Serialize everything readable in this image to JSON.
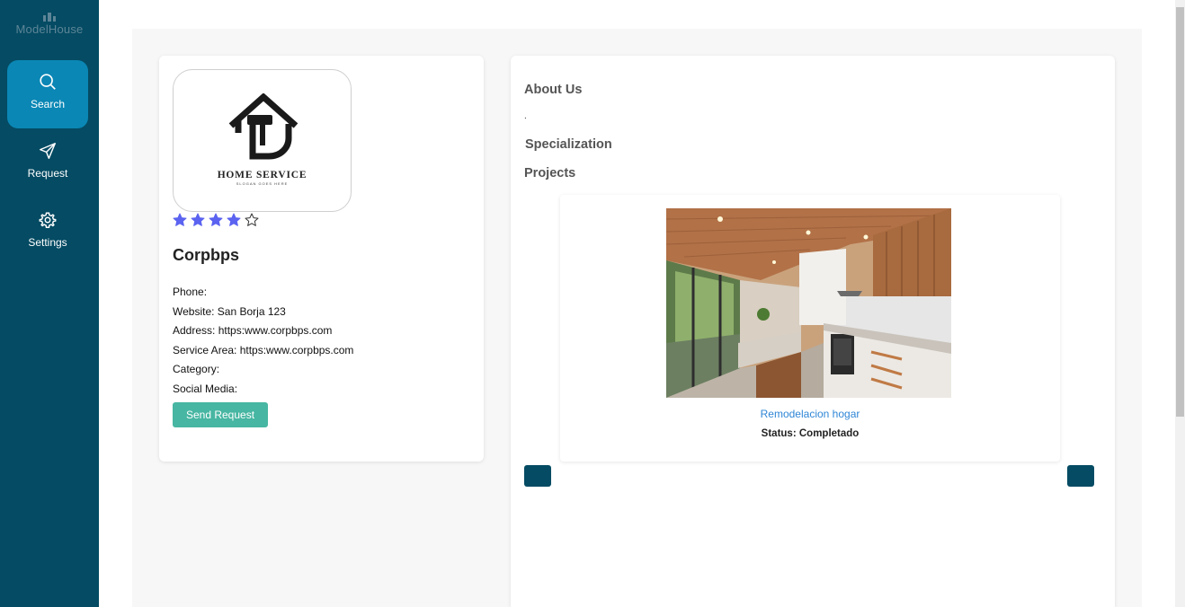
{
  "sidebar": {
    "logo": "ModelHouse",
    "items": [
      {
        "label": "Search",
        "icon": "search-icon",
        "active": true
      },
      {
        "label": "Request",
        "icon": "send-icon",
        "active": false
      },
      {
        "label": "Settings",
        "icon": "gear-icon",
        "active": false
      }
    ]
  },
  "profile": {
    "logo_title": "HOME SERVICE",
    "logo_tagline": "SLOGAN GOES HERE",
    "rating": 4,
    "rating_max": 5,
    "name": "Corpbps",
    "fields": {
      "phone": "Phone:",
      "website": "Website: San Borja 123",
      "address": "Address: https:www.corpbps.com",
      "service_area": "Service Area: https:www.corpbps.com",
      "category": "Category:",
      "social_media": "Social Media:"
    },
    "send_button": "Send Request"
  },
  "about": {
    "about_heading": "About Us",
    "about_text": ".",
    "specialization_heading": "Specialization",
    "projects_heading": "Projects"
  },
  "project": {
    "name": "Remodelacion hogar",
    "status_label": "Status:",
    "status_value": "Completado"
  },
  "colors": {
    "sidebar": "#044b63",
    "sidebar_active": "#0a87b5",
    "send_button": "#47b6a2",
    "star": "#5b63f0",
    "link": "#2f86d6"
  }
}
